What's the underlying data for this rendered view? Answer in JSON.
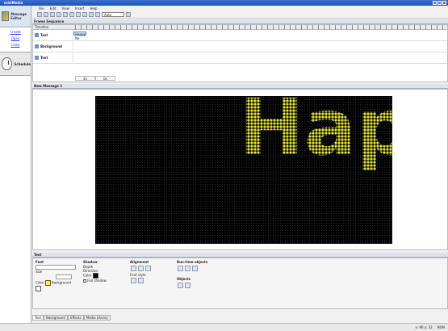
{
  "window": {
    "title": "ecktMedia"
  },
  "sidebar": {
    "header": "Message Editor",
    "links": [
      "Create",
      "Open",
      "Close"
    ],
    "schedule": "Schedule"
  },
  "menu": [
    "File",
    "Edit",
    "View",
    "Insert",
    "Help"
  ],
  "toolbar": {
    "zoom": "Auto"
  },
  "frame_sequence": {
    "title": "Frame Sequence",
    "timeline_label": "Timeline",
    "tracks": [
      {
        "name": "Text",
        "clip": "Happy Ne"
      },
      {
        "name": "Background"
      },
      {
        "name": "Text"
      }
    ],
    "footer": [
      "2s",
      "0s"
    ]
  },
  "message": {
    "tab": "New Message 1",
    "text": "Hap",
    "text_color": "#e7e629",
    "bg": "#000000"
  },
  "text_panel": {
    "title": "Text",
    "font": {
      "label": "Font",
      "size_label": "Size",
      "color_label": "Color",
      "bg_label": "Background",
      "color": "#ffff00"
    },
    "shadow": {
      "label": "Shadow",
      "depth": "Depth",
      "direction": "Direction",
      "color": "Color",
      "full": "Full shadow"
    },
    "alignment": {
      "label": "Alignment",
      "font_style": "Font style"
    },
    "runtime": {
      "label": "Run-time objects"
    },
    "objects": {
      "label": "Objects"
    }
  },
  "bottom_tabs": [
    "Text",
    "Background",
    "Effects",
    "Media Library"
  ],
  "status": [
    "x: 96  y: 32",
    "NUM"
  ]
}
